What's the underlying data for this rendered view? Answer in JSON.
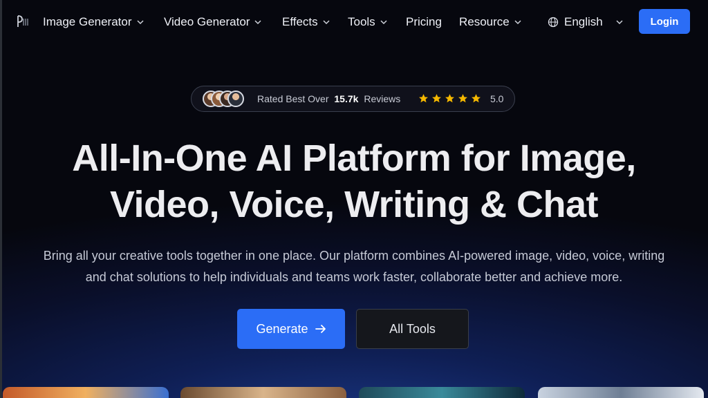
{
  "nav": {
    "logo_icon": "brand-logo-icon",
    "items": [
      {
        "label": "Image Generator",
        "has_dropdown": true
      },
      {
        "label": "Video Generator",
        "has_dropdown": true
      },
      {
        "label": "Effects",
        "has_dropdown": true
      },
      {
        "label": "Tools",
        "has_dropdown": true
      },
      {
        "label": "Pricing",
        "has_dropdown": false
      },
      {
        "label": "Resource",
        "has_dropdown": true
      }
    ],
    "language": "English",
    "login_label": "Login"
  },
  "rating": {
    "prefix": "Rated Best Over",
    "count": "15.7k",
    "suffix": "Reviews",
    "stars": 5,
    "score": "5.0"
  },
  "hero": {
    "headline_line1": "All-In-One AI Platform for Image,",
    "headline_line2": "Video, Voice, Writing & Chat",
    "subtitle_line1": "Bring all your creative tools together in one place. Our platform combines AI-powered image, video, voice, writing",
    "subtitle_line2": "and chat solutions to help individuals and teams work faster, collaborate better and achieve more.",
    "generate_label": "Generate",
    "all_tools_label": "All Tools"
  },
  "colors": {
    "accent": "#2b6df6",
    "star": "#f5b800",
    "background": "#06070e"
  }
}
